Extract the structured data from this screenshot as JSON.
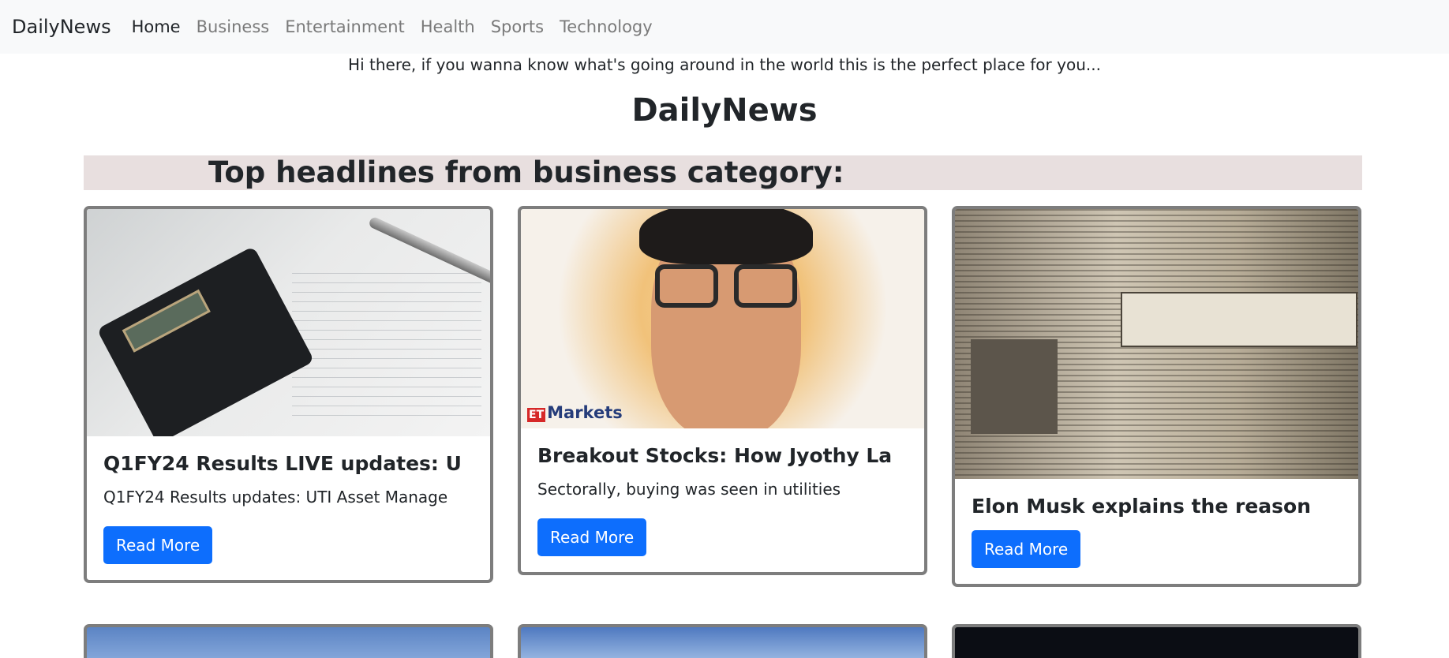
{
  "navbar": {
    "brand": "DailyNews",
    "links": [
      "Home",
      "Business",
      "Entertainment",
      "Health",
      "Sports",
      "Technology"
    ]
  },
  "tagline": "Hi there, if you wanna know what's going around in the world this is the perfect place for you...",
  "page_title": "DailyNews",
  "section_heading": "Top headlines from business category:",
  "cards": [
    {
      "title": "Q1FY24 Results LIVE updates: U",
      "description": "Q1FY24 Results updates: UTI Asset Manage",
      "button": "Read More",
      "image_icon": "calculator-paper-image"
    },
    {
      "title": "Breakout Stocks: How Jyothy La",
      "description": "Sectorally, buying was seen in utilities",
      "button": "Read More",
      "image_icon": "portrait-illustration-image",
      "image_logo": {
        "et": "ET",
        "markets": "Markets"
      }
    },
    {
      "title": "Elon Musk explains the reason",
      "description": "",
      "button": "Read More",
      "image_icon": "newspaper-image"
    }
  ],
  "colors": {
    "navbar_bg": "#f8f9fa",
    "section_bar_bg": "#e8dfdf",
    "button_bg": "#0d6efd",
    "card_border": "#7d7d7d"
  }
}
